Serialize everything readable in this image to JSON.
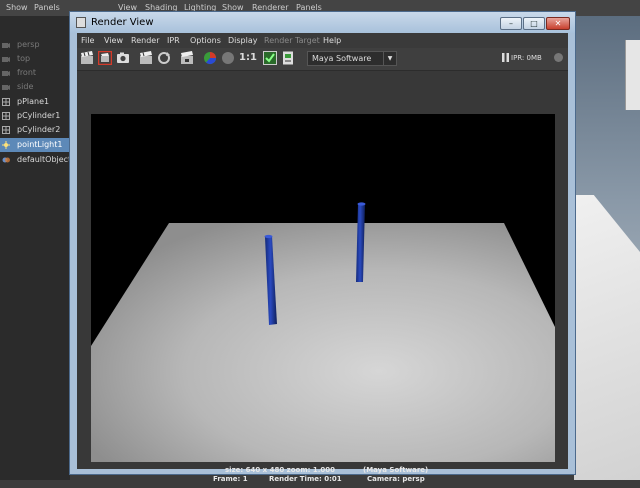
{
  "background": {
    "menu": [
      "Show",
      "Panels",
      "View",
      "Shading",
      "Lighting",
      "Show",
      "Renderer",
      "Panels"
    ],
    "outliner": [
      {
        "label": "persp",
        "state": "dim"
      },
      {
        "label": "top",
        "state": "dim"
      },
      {
        "label": "front",
        "state": "dim"
      },
      {
        "label": "side",
        "state": "dim"
      },
      {
        "label": "pPlane1",
        "state": "normal"
      },
      {
        "label": "pCylinder1",
        "state": "normal"
      },
      {
        "label": "pCylinder2",
        "state": "normal"
      },
      {
        "label": "pointLight1",
        "state": "selected"
      },
      {
        "label": "defaultObjectSet",
        "state": "normal"
      }
    ]
  },
  "window": {
    "title": "Render View",
    "controls": {
      "minimize": "–",
      "maximize": "□",
      "close": "✕"
    },
    "menu": [
      {
        "label": "File",
        "enabled": true
      },
      {
        "label": "View",
        "enabled": true
      },
      {
        "label": "Render",
        "enabled": true
      },
      {
        "label": "IPR",
        "enabled": true
      },
      {
        "label": "Options",
        "enabled": true
      },
      {
        "label": "Display",
        "enabled": true
      },
      {
        "label": "Render Target",
        "enabled": false
      },
      {
        "label": "Help",
        "enabled": true
      }
    ],
    "toolbar": {
      "icons": [
        "clapboard-icon",
        "redo-render-icon",
        "snapshot-icon",
        "ipr-render-icon",
        "refresh-icon",
        "clapboard-region-icon",
        "color-channels-icon",
        "alpha-channel-icon",
        "one-to-one-icon",
        "keep-image-icon",
        "remove-image-icon"
      ],
      "one_to_one_label": "1:1",
      "renderer": "Maya Software",
      "ipr_memory": "IPR: 0MB"
    },
    "info": {
      "size_line": "size: 640 x 480 zoom: 1.000",
      "renderer_line": "(Maya Software)",
      "frame_line": "Frame: 1",
      "time_line": "Render Time: 0:01",
      "camera_line": "Camera: persp"
    }
  },
  "colors": {
    "selection": "#5d89b8",
    "cylinder": "#1f3ca8",
    "render_background": "#000000"
  }
}
